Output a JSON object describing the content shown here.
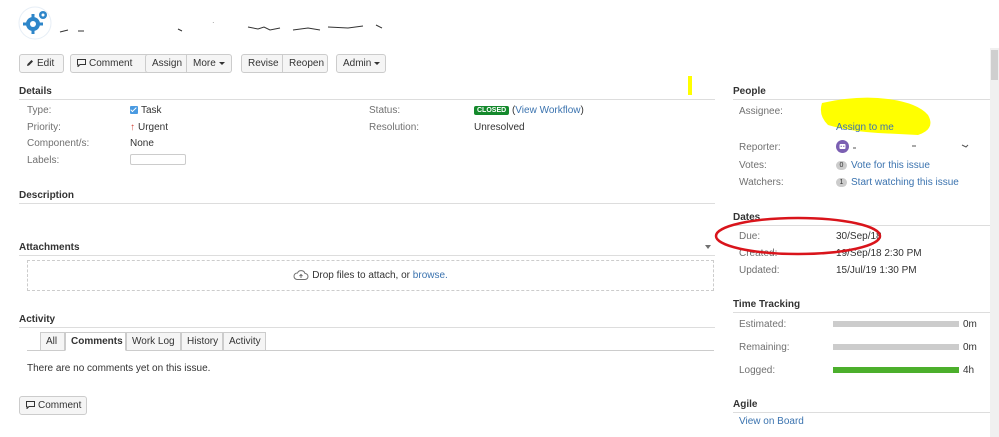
{
  "toolbar": {
    "edit": "Edit",
    "comment": "Comment",
    "assign": "Assign",
    "more": "More",
    "revise": "Revise",
    "reopen": "Reopen",
    "admin": "Admin"
  },
  "details": {
    "heading": "Details",
    "type_label": "Type:",
    "type_value": "Task",
    "priority_label": "Priority:",
    "priority_value": "Urgent",
    "components_label": "Component/s:",
    "components_value": "None",
    "labels_label": "Labels:",
    "status_label": "Status:",
    "status_value": "CLOSED",
    "view_workflow": "View Workflow",
    "resolution_label": "Resolution:",
    "resolution_value": "Unresolved"
  },
  "description": {
    "heading": "Description"
  },
  "attachments": {
    "heading": "Attachments",
    "drop_text": "Drop files to attach, or",
    "browse": "browse."
  },
  "activity": {
    "heading": "Activity",
    "tabs": [
      "All",
      "Comments",
      "Work Log",
      "History",
      "Activity"
    ],
    "active_tab": "Comments",
    "empty_text": "There are no comments yet on this issue.",
    "comment_button": "Comment"
  },
  "people": {
    "heading": "People",
    "assignee_label": "Assignee:",
    "assign_to_me": "Assign to me",
    "reporter_label": "Reporter:",
    "votes_label": "Votes:",
    "votes_count": "0",
    "vote_link": "Vote for this issue",
    "watchers_label": "Watchers:",
    "watchers_count": "1",
    "watch_link": "Start watching this issue"
  },
  "dates": {
    "heading": "Dates",
    "due_label": "Due:",
    "due_value": "30/Sep/18",
    "created_label": "Created:",
    "created_value": "19/Sep/18 2:30 PM",
    "updated_label": "Updated:",
    "updated_value": "15/Jul/19 1:30 PM"
  },
  "time_tracking": {
    "heading": "Time Tracking",
    "estimated_label": "Estimated:",
    "estimated_value": "0m",
    "remaining_label": "Remaining:",
    "remaining_value": "0m",
    "logged_label": "Logged:",
    "logged_value": "4h",
    "logged_fraction": 1.0
  },
  "agile": {
    "heading": "Agile",
    "view_on_board": "View on Board"
  },
  "colors": {
    "link": "#3b73af",
    "closed": "#14892c",
    "logged_bar": "#4caf2c",
    "annotation_circle": "#d9141b",
    "redaction": "#ffff00"
  }
}
